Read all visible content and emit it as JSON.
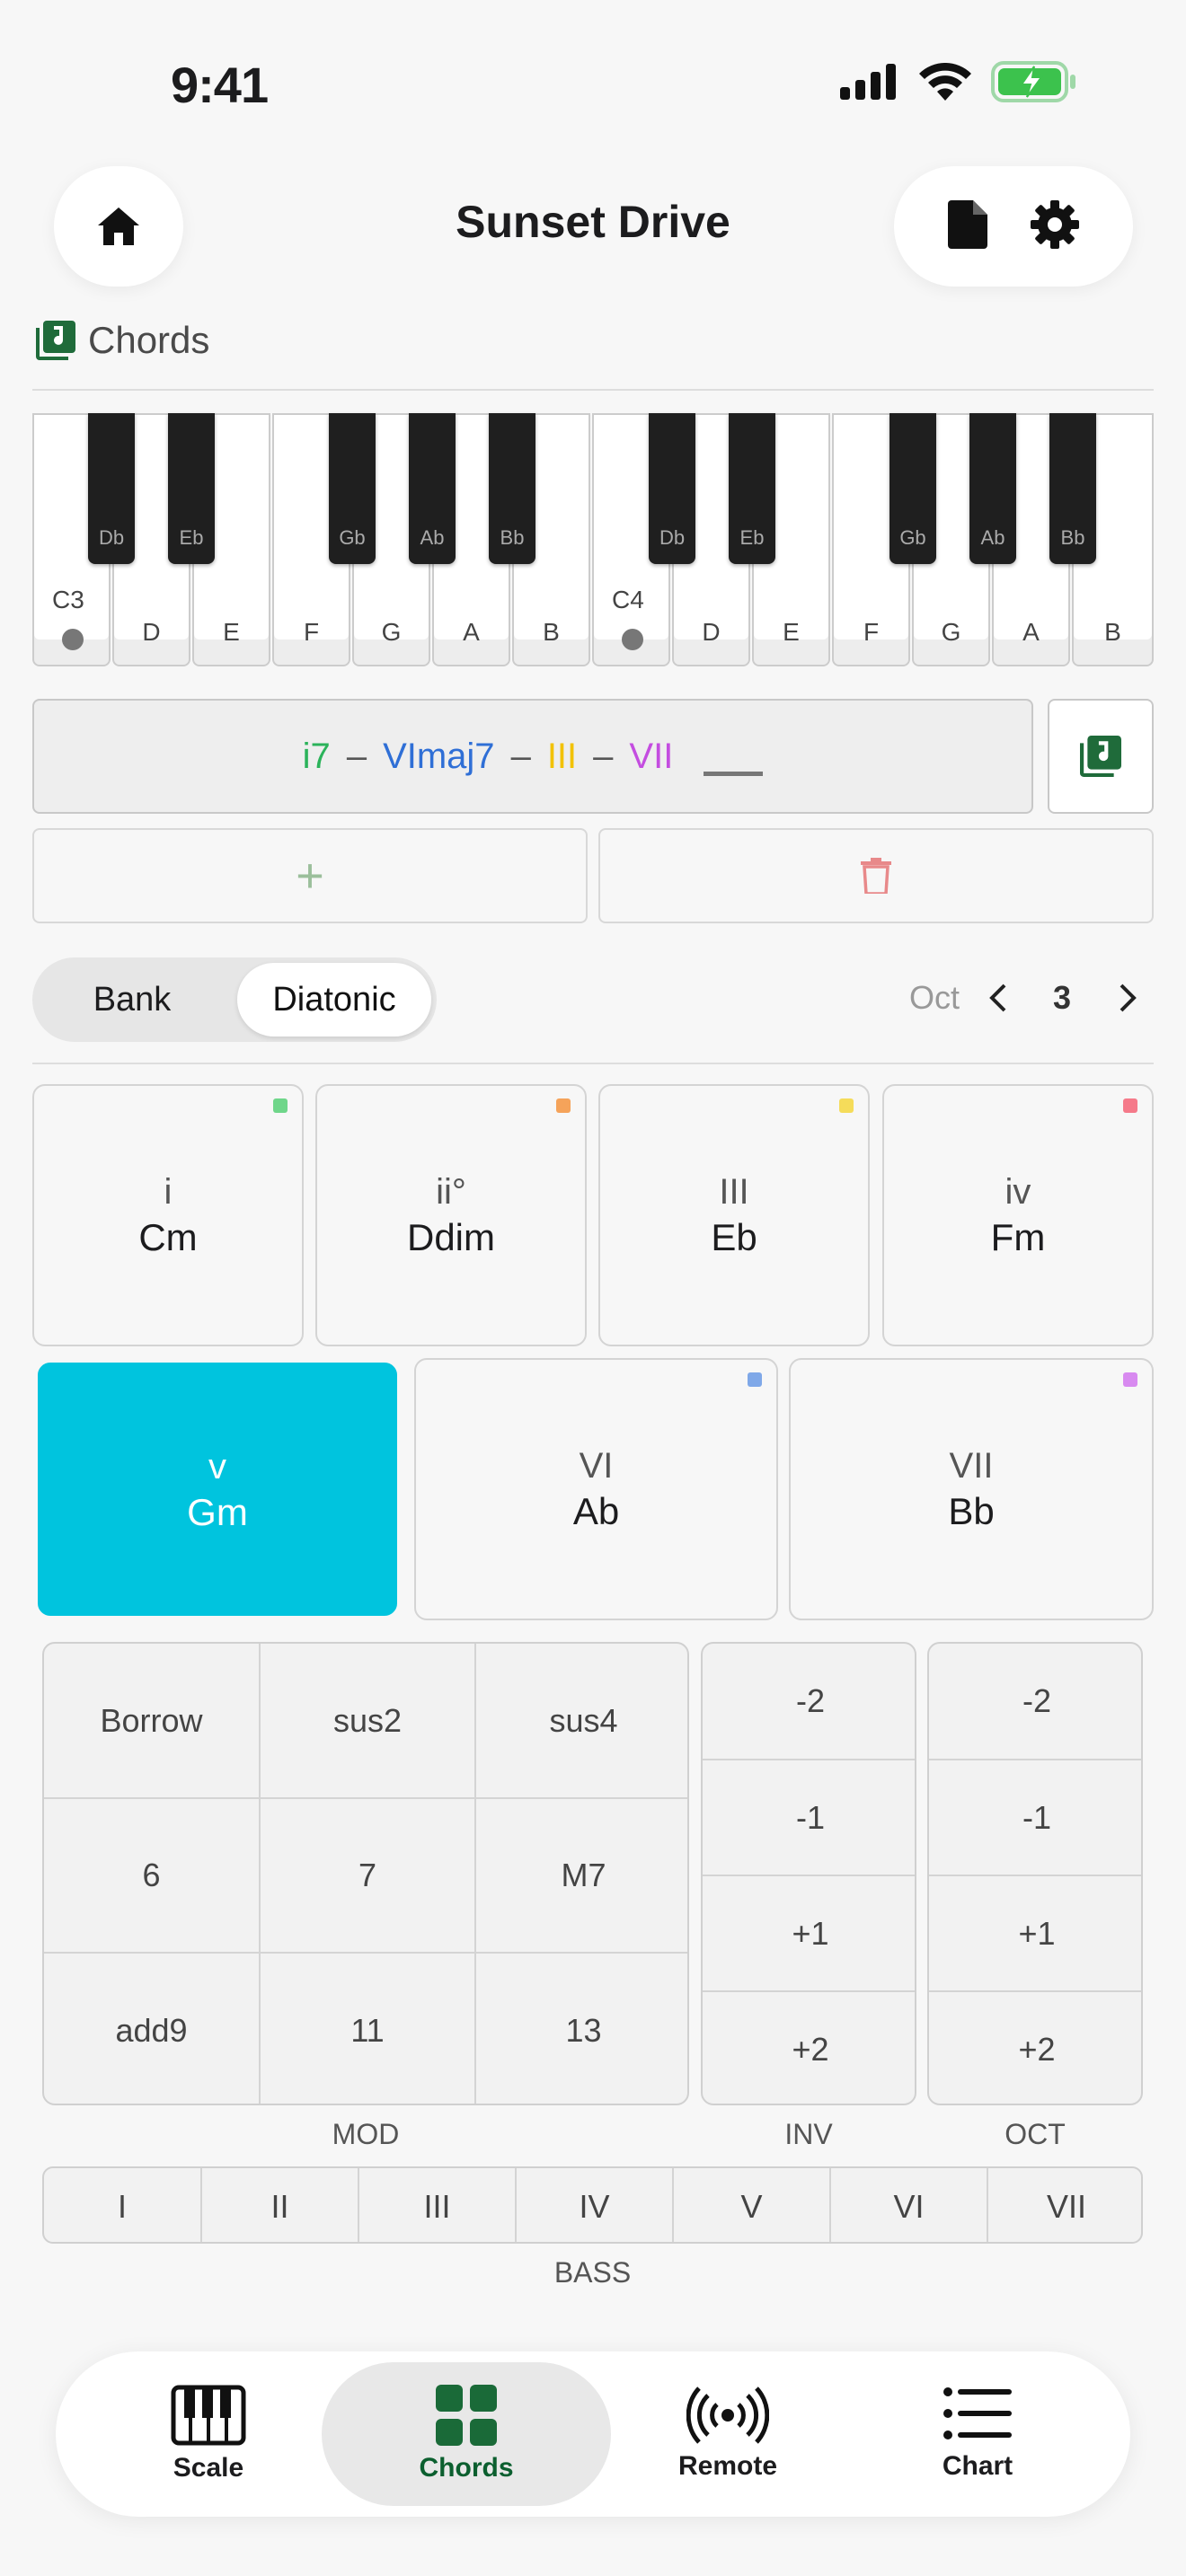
{
  "status": {
    "time": "9:41"
  },
  "header": {
    "title": "Sunset Drive"
  },
  "section": {
    "label": "Chords"
  },
  "piano": {
    "white_keys": [
      "C",
      "D",
      "E",
      "F",
      "G",
      "A",
      "B",
      "C",
      "D",
      "E",
      "F",
      "G",
      "A",
      "B"
    ],
    "octave_labels": [
      "C3",
      "C4"
    ],
    "black_keys": [
      "Db",
      "Eb",
      "Gb",
      "Ab",
      "Bb",
      "Db",
      "Eb",
      "Gb",
      "Ab",
      "Bb"
    ]
  },
  "progression": {
    "chords": [
      {
        "label": "i7",
        "color": "#2bb35a"
      },
      {
        "label": "VImaj7",
        "color": "#2f6fd6"
      },
      {
        "label": "III",
        "color": "#f2c200"
      },
      {
        "label": "VII",
        "color": "#c44de0"
      }
    ],
    "separator": "–"
  },
  "actions": {
    "add_label": "+"
  },
  "mode_toggle": {
    "bank": "Bank",
    "diatonic": "Diatonic",
    "selected": "Diatonic"
  },
  "octave_nav": {
    "label": "Oct",
    "value": "3"
  },
  "chords_row1": [
    {
      "roman": "i",
      "name": "Cm",
      "color": "#6fd68a"
    },
    {
      "roman": "ii°",
      "name": "Ddim",
      "color": "#f5a35a"
    },
    {
      "roman": "III",
      "name": "Eb",
      "color": "#f5dc5a"
    },
    {
      "roman": "iv",
      "name": "Fm",
      "color": "#f57a8a"
    }
  ],
  "chords_row2": [
    {
      "roman": "v",
      "name": "Gm",
      "color": "#00c4de",
      "selected": true
    },
    {
      "roman": "VI",
      "name": "Ab",
      "color": "#7fa8e8"
    },
    {
      "roman": "VII",
      "name": "Bb",
      "color": "#d88af0"
    }
  ],
  "mod": {
    "cells": [
      "Borrow",
      "sus2",
      "sus4",
      "6",
      "7",
      "M7",
      "add9",
      "11",
      "13"
    ],
    "label": "MOD"
  },
  "inv": {
    "cells": [
      "-2",
      "-1",
      "+1",
      "+2"
    ],
    "label": "INV"
  },
  "oct": {
    "cells": [
      "-2",
      "-1",
      "+1",
      "+2"
    ],
    "label": "OCT"
  },
  "bass": {
    "cells": [
      "I",
      "II",
      "III",
      "IV",
      "V",
      "VI",
      "VII"
    ],
    "label": "BASS"
  },
  "tabs": [
    {
      "label": "Scale",
      "icon": "piano-icon"
    },
    {
      "label": "Chords",
      "icon": "grid-icon",
      "active": true
    },
    {
      "label": "Remote",
      "icon": "broadcast-icon"
    },
    {
      "label": "Chart",
      "icon": "list-icon"
    }
  ]
}
